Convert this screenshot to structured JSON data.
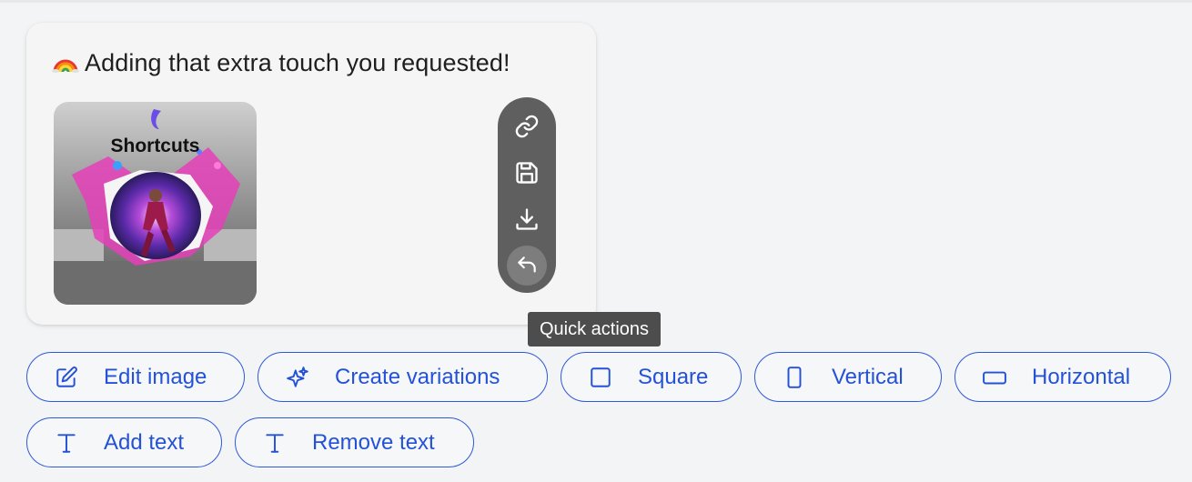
{
  "message": {
    "emoji": "rainbow",
    "text": "Adding that extra touch you requested!"
  },
  "image": {
    "overlay_text": "Shortcuts"
  },
  "quick_actions": {
    "tooltip": "Quick actions",
    "buttons": [
      {
        "icon": "link-icon"
      },
      {
        "icon": "save-icon"
      },
      {
        "icon": "download-icon"
      },
      {
        "icon": "reply-icon",
        "active": true
      }
    ]
  },
  "suggestions": [
    {
      "label": "Edit image",
      "icon": "edit-icon"
    },
    {
      "label": "Create variations",
      "icon": "sparkle-icon"
    },
    {
      "label": "Square",
      "icon": "square-icon"
    },
    {
      "label": "Vertical",
      "icon": "vertical-rect-icon"
    },
    {
      "label": "Horizontal",
      "icon": "horizontal-rect-icon"
    },
    {
      "label": "Add text",
      "icon": "text-icon"
    },
    {
      "label": "Remove text",
      "icon": "text-icon"
    }
  ],
  "colors": {
    "accent": "#2452d6",
    "border": "#2f59d6",
    "tooltip_bg": "#4d4d4d",
    "toolbar_bg": "#5f5f5f"
  }
}
